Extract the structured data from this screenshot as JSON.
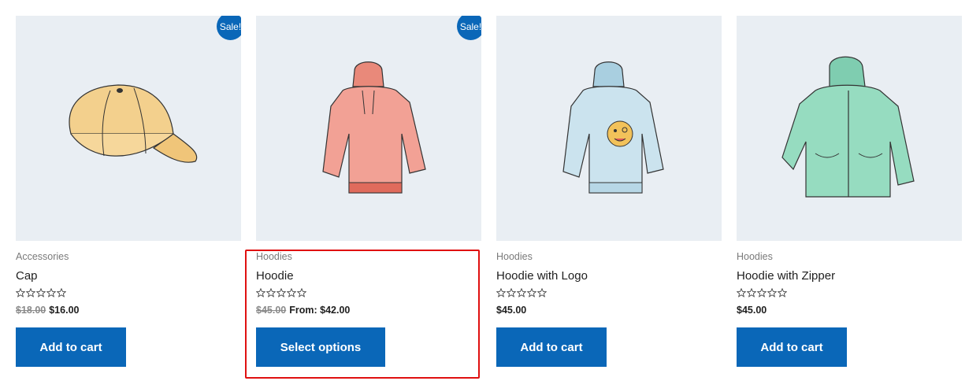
{
  "products": [
    {
      "category": "Accessories",
      "title": "Cap",
      "sale_badge": "Sale!",
      "old_price": "$18.00",
      "price": "$16.00",
      "button": "Add to cart",
      "rating_stars": 0,
      "max_stars": 5,
      "image_icon": "cap-image"
    },
    {
      "category": "Hoodies",
      "title": "Hoodie",
      "sale_badge": "Sale!",
      "old_price": "$45.00",
      "price": "From: $42.00",
      "button": "Select options",
      "rating_stars": 0,
      "max_stars": 5,
      "image_icon": "hoodie-image"
    },
    {
      "category": "Hoodies",
      "title": "Hoodie with Logo",
      "old_price": "",
      "price": "$45.00",
      "button": "Add to cart",
      "rating_stars": 0,
      "max_stars": 5,
      "image_icon": "hoodie-logo-image"
    },
    {
      "category": "Hoodies",
      "title": "Hoodie with Zipper",
      "old_price": "",
      "price": "$45.00",
      "button": "Add to cart",
      "rating_stars": 0,
      "max_stars": 5,
      "image_icon": "hoodie-zipper-image"
    }
  ],
  "colors": {
    "accent": "#0a67b8",
    "thumb_bg": "#e9eef3",
    "highlight": "#e01010"
  }
}
